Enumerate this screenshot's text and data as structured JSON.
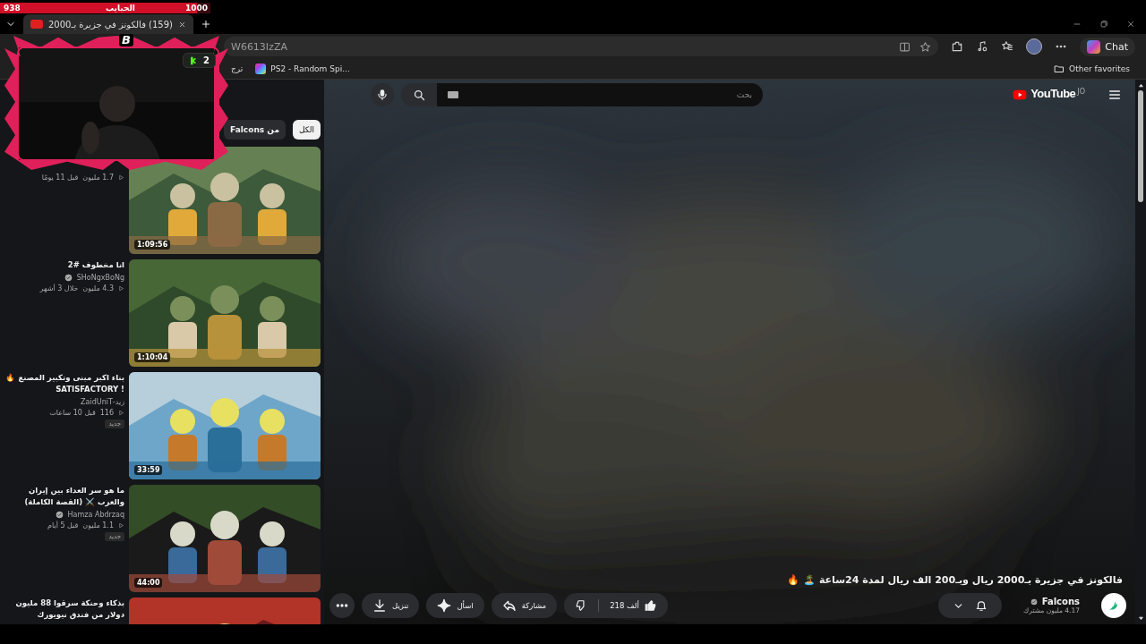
{
  "stream_overlay": {
    "goal": {
      "current": "938",
      "label": "الحبايب",
      "target": "1000",
      "level": 0.938
    },
    "webcam": {
      "logo": "B",
      "viewer_count": "2"
    }
  },
  "browser": {
    "tab": {
      "title": "(159) فالكونز في جزيرة بـ2000",
      "selected": true
    },
    "address": "W6613IzZA",
    "chat_label": "Chat",
    "bookmarks": [
      {
        "label": "PS2 - Random Spi..."
      },
      {
        "label": "ترج"
      }
    ],
    "other_favorites": "Other favorites"
  },
  "header": {
    "search_placeholder": "بحث",
    "logo": "YouTube",
    "country": "JO"
  },
  "chips": [
    {
      "label": "الكل",
      "selected": true
    },
    {
      "label": "من Falcons",
      "selected": false
    }
  ],
  "related": [
    {
      "views": "1.7 مليون",
      "age": "قبل 11 يومًا",
      "duration": "1:09:56"
    },
    {
      "title": "انا مخطوف #2",
      "channel": "SHoNgxBoNg",
      "verified": true,
      "views": "4.3 مليون",
      "age": "خلال 3 أشهر",
      "duration": "1:10:04"
    },
    {
      "title": "بناء اكبر مبنى وتكبير المصنع 🔥 ! SATISFACTORY",
      "channel": "زيد-ZaidUniT",
      "verified": false,
      "views": "116",
      "age": "قبل 10 ساعات",
      "badge": "جديد",
      "duration": "33:59"
    },
    {
      "title": "ما هو سر العداء بين إيران والعرب ⚔️ (القصة الكاملة)",
      "channel": "Hamza Abdrzaq",
      "verified": true,
      "views": "1.1 مليون",
      "age": "قبل 5 أيام",
      "badge": "جديد",
      "duration": "44:00"
    },
    {
      "title": "بذكاء وحنكة سرقوا 88 مليون دولار من فندق نيويورك"
    }
  ],
  "video": {
    "title": "فالكونز في جزيرة بـ2000 ريال وبـ200 الف ريال لمدة 24ساعة 🏝️ 🔥",
    "channel": "Falcons",
    "subscribers": "4.17 مليون مشترك",
    "likes": "218 ألف",
    "actions": [
      {
        "kind": "share",
        "label": "مشاركة"
      },
      {
        "kind": "ask",
        "label": "اسأل"
      },
      {
        "kind": "download",
        "label": "تنزيل"
      },
      {
        "kind": "more"
      }
    ]
  }
}
